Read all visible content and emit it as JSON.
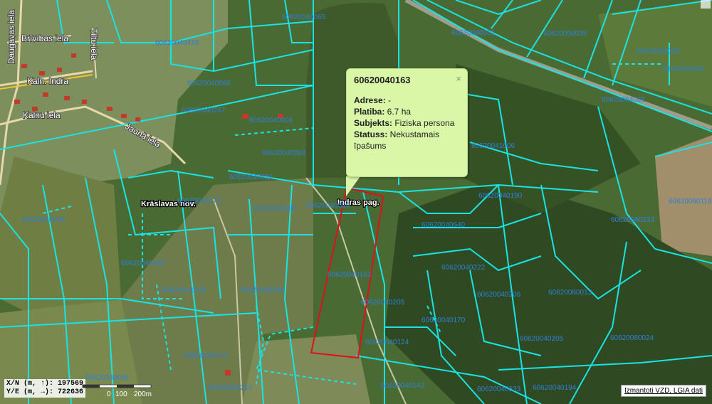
{
  "popup": {
    "title": "60620040163",
    "close": "×",
    "rows": [
      {
        "key": "Adrese:",
        "value": " -"
      },
      {
        "key": "Platiba:",
        "value": " 6.7 ha"
      },
      {
        "key": "Subjekts:",
        "value": " Fiziska persona"
      },
      {
        "key": "Statuss:",
        "value": " Nekustamais īpašums"
      }
    ]
  },
  "coords": {
    "line1": "X/N (m, ↑): 197569",
    "line2": "Y/E (m, →): 722636"
  },
  "scale": {
    "a": "0",
    "b": "100",
    "c": "200m"
  },
  "attribution": "Izmantoti VZD, LGIA dati",
  "places": {
    "kraslavas": "Krāslavas nov.",
    "indras": "Indras pag."
  },
  "streets": {
    "s1": "Daugavas iela",
    "s2": "Brīvības iela",
    "s3": "Kalnu iela",
    "s4": "Kaln. Indra",
    "s5": "Tiltu iela",
    "s6": "Jaunā iela"
  },
  "parcel_labels": {
    "p01": "60620040065",
    "p02": "60620040031",
    "p03": "60620050039",
    "p04": "60620050028",
    "p05": "60620040470",
    "p06": "60620040068",
    "p07": "60620040247",
    "p08": "60620040004",
    "p09": "60620054001",
    "p10": "60620040093",
    "p11": "60620041006",
    "p12": "60620040624",
    "p13": "60620040172",
    "p14": "60620040088",
    "p15": "60620040190",
    "p16": "60620080119",
    "p17": "60620040005",
    "p18": "60620040640",
    "p19": "60620080233",
    "p20": "60620040168",
    "p21": "60620040163",
    "p22": "60620040222",
    "p23": "60620041039",
    "p24": "60620040084",
    "p25": "60620040205",
    "p26": "60620040206",
    "p27": "60620080013",
    "p28": "60620040170",
    "p29": "60620040205",
    "p30": "60620080024",
    "p31": "60620040176",
    "p32": "60620040124",
    "p33": "60620040656",
    "p34": "60620042214",
    "p35": "60620040143",
    "p36": "60620040633",
    "p37": "60620040194",
    "p38": "60620040001",
    "p39": "60620040089"
  },
  "colors": {
    "parcel_boundary": "#19e3e3",
    "selected_parcel": "#e0101a",
    "parcel_label": "#2f7fd6",
    "popup_bg": "#d9f7a6"
  }
}
